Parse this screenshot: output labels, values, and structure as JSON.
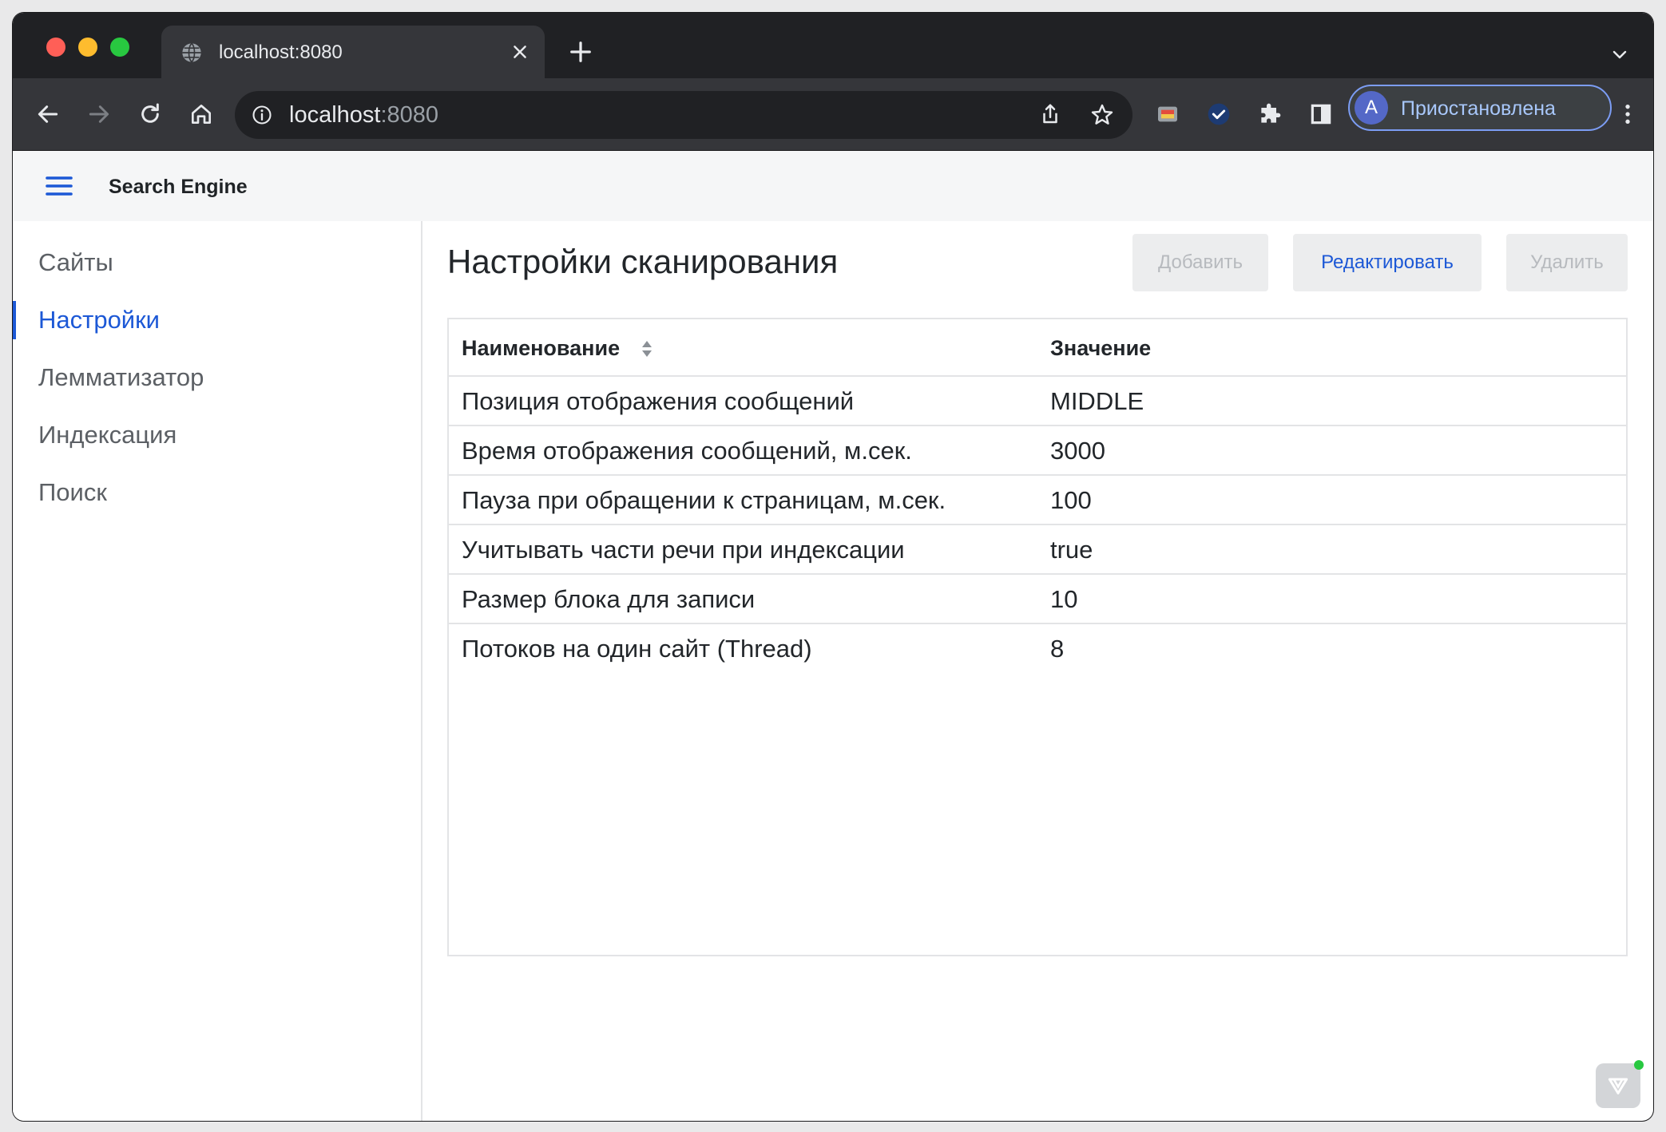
{
  "browser": {
    "tab_title": "localhost:8080",
    "url_host": "localhost",
    "url_port": ":8080",
    "profile_initial": "A",
    "profile_status": "Приостановлена"
  },
  "app": {
    "brand": "Search Engine"
  },
  "sidebar": {
    "items": [
      {
        "label": "Сайты"
      },
      {
        "label": "Настройки"
      },
      {
        "label": "Лемматизатор"
      },
      {
        "label": "Индексация"
      },
      {
        "label": "Поиск"
      }
    ],
    "active_index": 1
  },
  "content": {
    "title": "Настройки сканирования",
    "buttons": {
      "add": "Добавить",
      "edit": "Редактировать",
      "delete": "Удалить"
    },
    "table": {
      "headers": [
        "Наименование",
        "Значение"
      ],
      "rows": [
        {
          "name": "Позиция отображения сообщений",
          "value": "MIDDLE"
        },
        {
          "name": "Время отображения сообщений, м.сек.",
          "value": "3000"
        },
        {
          "name": "Пауза при обращении к страницам, м.сек.",
          "value": "100"
        },
        {
          "name": "Учитывать части речи при индексации",
          "value": "true"
        },
        {
          "name": "Размер блока для записи",
          "value": "10"
        },
        {
          "name": "Потоков на один сайт (Thread)",
          "value": "8"
        }
      ]
    }
  },
  "colors": {
    "accent": "#1c58d6",
    "chrome_dark": "#202124",
    "chrome_toolbar": "#35363a"
  }
}
